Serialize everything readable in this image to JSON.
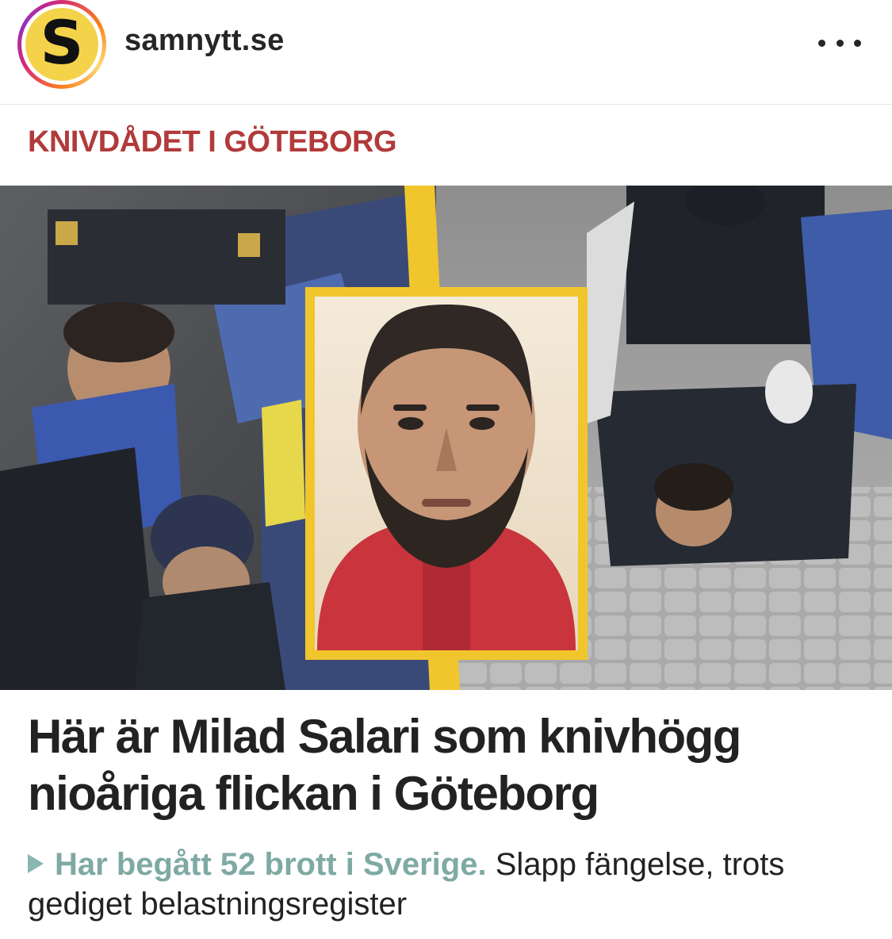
{
  "post": {
    "account_name": "samnytt.se",
    "avatar_letter": "S",
    "avatar_icon": "samnytt-logo-icon",
    "more_icon": "more-options-icon"
  },
  "article": {
    "section_label": "KNIVDÅDET I GÖTEBORG",
    "headline": "Här är Milad Salari som knivhögg nioåriga flickan i Göteborg",
    "sub_highlight": "Har begått 52 brott i Sverige.",
    "sub_rest": " Slapp fängelse, trots gediget belastningsregister"
  },
  "colors": {
    "section_label": "#b13a3a",
    "sub_highlight": "#7eaaa3",
    "accent_yellow": "#f1c62d",
    "avatar_bg": "#f4d34b"
  }
}
